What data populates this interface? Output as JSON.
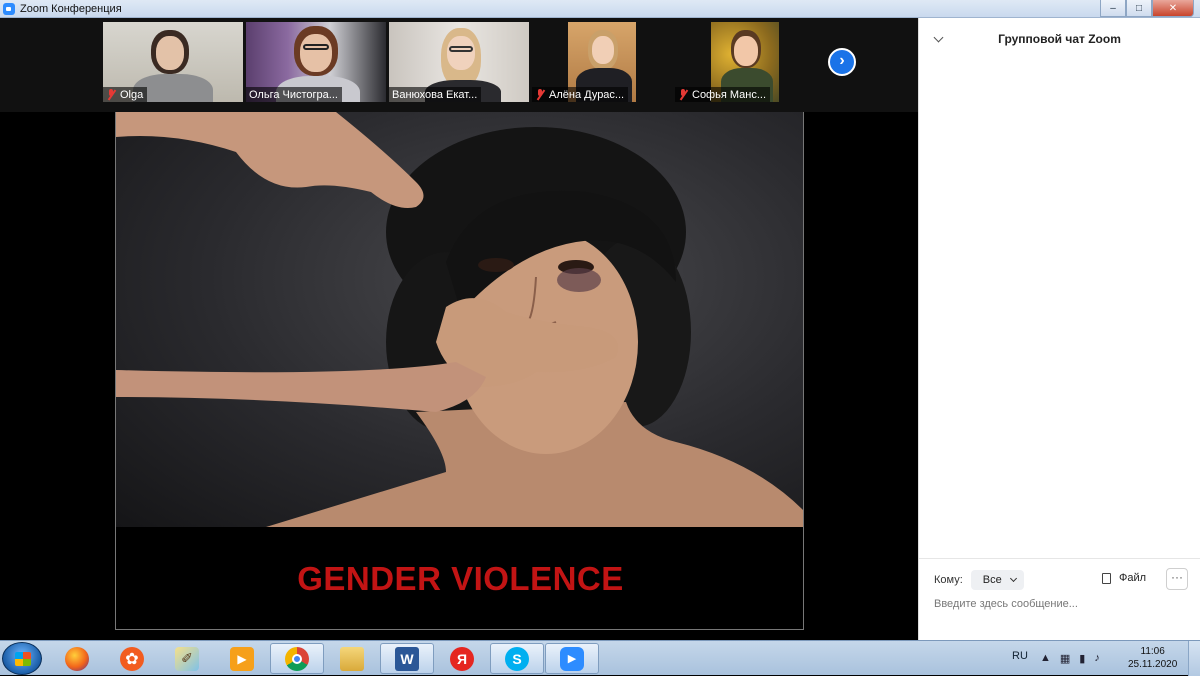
{
  "window": {
    "title": "Zoom Конференция"
  },
  "participants": [
    {
      "name": "Olga"
    },
    {
      "name": "Ольга Чистогра..."
    },
    {
      "name": "Ванюхова Екат..."
    },
    {
      "name": "Алёна Дурас..."
    },
    {
      "name": "Софья Манс..."
    }
  ],
  "share": {
    "slide_caption": "GENDER VIOLENCE"
  },
  "chat": {
    "title": "Групповой чат Zoom",
    "to_label": "Кому:",
    "to_value": "Все",
    "file_label": "Файл",
    "more_label": "···",
    "input_placeholder": "Введите здесь сообщение..."
  },
  "taskbar": {
    "language": "RU",
    "time": "11:06",
    "date": "25.11.2020",
    "apps": [
      "firefox-icon",
      "app-orange-icon",
      "paint-icon",
      "media-player-icon",
      "chrome-icon",
      "explorer-icon",
      "word-icon",
      "yandex-icon",
      "skype-icon",
      "zoom-icon"
    ]
  },
  "colors": {
    "caption_red": "#c21414",
    "zoom_blue": "#2d8cff",
    "mic_off_red": "#e53935"
  }
}
